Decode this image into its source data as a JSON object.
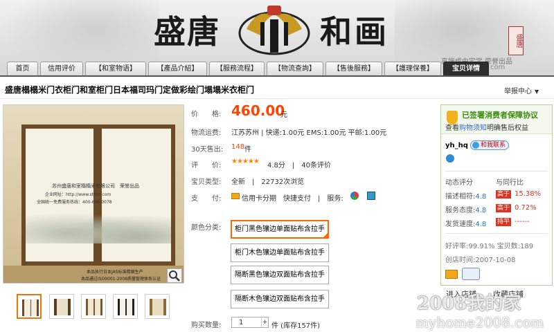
{
  "banner": {
    "logo_left": "盛唐",
    "logo_right": "和画",
    "slogan": "高端成由定学 荣誉出品",
    "stamp": "盛唐"
  },
  "nav": {
    "tabs": [
      "首页",
      "信用评价",
      "【和室物语】",
      "【產品介紹】",
      "【服務流程】",
      "【物流查詢】",
      "【售後服務】",
      "【護理保養】",
      "宝贝详情"
    ],
    "active": "宝贝详情",
    "tail": "com"
  },
  "product": {
    "title": "盛唐榻榻米门衣柜门和室柜门日本福司玛门定做彩绘门塌塌米衣柜门",
    "report": "举报中心",
    "image_text": {
      "line1": "苏州盛唐和室榻榻米有限公司　荣誉出品",
      "line2": "企业网址：http://www.stttm.com",
      "line3": "全国统一免费服务热线：400-606-0078",
      "line4": "本品执行日本JAS标准精细生产",
      "line5": "本品通过ISO9001-2008质量管理体系认证"
    }
  },
  "info": {
    "price_label": "价　　格:",
    "price": "460.00",
    "price_unit": "元",
    "shipping_label": "物流运费:",
    "shipping": "江苏苏州 | 快递:1.00元 EMS:1.00元 平邮:1.00元",
    "sold_label": "30天售出:",
    "sold_count": "148",
    "sold_unit": "件",
    "rating_label": "评　　价:",
    "stars": "★★★★★",
    "rating": "4.8分　|　40条评价",
    "type_label": "宝贝类型:",
    "type": "全新　|　22732次浏览",
    "pay_label": "支　　付:",
    "pay": "信用卡分期　快捷支付　|　服务:",
    "color_label": "颜色分类:",
    "options": [
      "柜门黑色镶边单面贴布含拉手",
      "柜门木色镶边单面贴布含拉手",
      "隔断黑色镶边双面贴布含拉手",
      "隔断木色镶边双面贴布含拉手"
    ],
    "selected_option": 0,
    "qty_label": "购买数量:",
    "qty": "1",
    "qty_unit": "件 (库存157件)"
  },
  "seller": {
    "promise_title": "已签署消费者保障协议",
    "promise_prefix": "查看",
    "promise_link": "购物须知",
    "promise_suffix": "明确售后权益",
    "name": "yh_hq",
    "chat": "和我联系",
    "dyn_title": "动态评分",
    "cmp_title": "与同行比",
    "rows": [
      {
        "label": "描述相符:",
        "score": "4.8",
        "tag": "高于",
        "pct": "15.38%"
      },
      {
        "label": "服务态度:",
        "score": "4.8",
        "tag": "高于",
        "pct": "0.72%"
      },
      {
        "label": "发货速度:",
        "score": "4.8",
        "tag": "持平",
        "pct": "------"
      }
    ],
    "good_rate": "好评率:99.91%  宝贝数:189",
    "created": "创店时间:2007-10-08",
    "enter_btn": "进入店铺",
    "fav_btn": "收藏店铺"
  },
  "watermark": {
    "line1": "2008我的家",
    "line2": "myhome2008.com"
  }
}
